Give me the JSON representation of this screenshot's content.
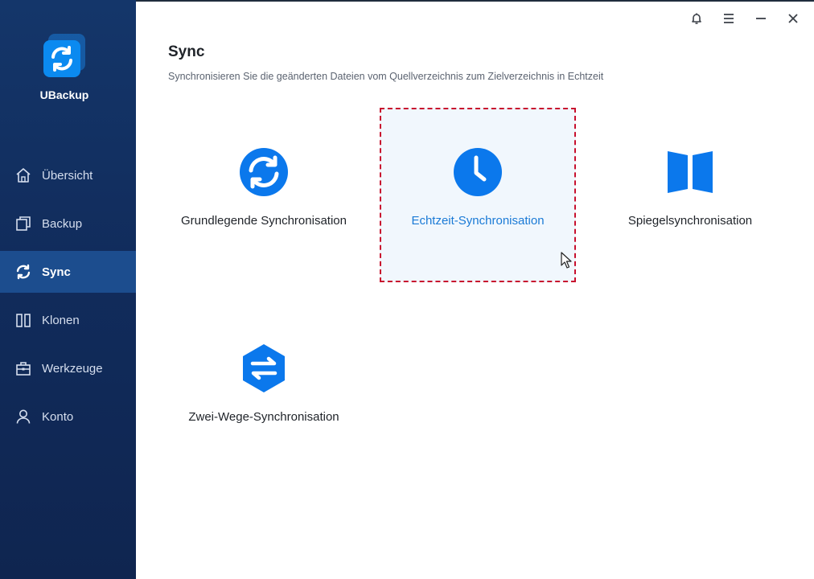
{
  "app": {
    "name": "UBackup"
  },
  "sidebar": {
    "items": [
      {
        "label": "Übersicht",
        "icon": "home-icon"
      },
      {
        "label": "Backup",
        "icon": "backup-icon"
      },
      {
        "label": "Sync",
        "icon": "sync-icon",
        "active": true
      },
      {
        "label": "Klonen",
        "icon": "clone-icon"
      },
      {
        "label": "Werkzeuge",
        "icon": "toolbox-icon"
      },
      {
        "label": "Konto",
        "icon": "user-icon"
      }
    ]
  },
  "window_controls": [
    "bell-icon",
    "menu-icon",
    "minimize-icon",
    "close-icon"
  ],
  "page": {
    "title": "Sync",
    "subtitle": "Synchronisieren Sie die geänderten Dateien vom Quellverzeichnis zum Zielverzeichnis in Echtzeit"
  },
  "options": [
    {
      "label": "Grundlegende Synchronisation",
      "icon": "basic-sync-icon"
    },
    {
      "label": "Echtzeit-Synchronisation",
      "icon": "realtime-clock-icon",
      "selected": true
    },
    {
      "label": "Spiegelsynchronisation",
      "icon": "mirror-icon"
    },
    {
      "label": "Zwei-Wege-Synchronisation",
      "icon": "two-way-arrows-icon"
    }
  ],
  "colors": {
    "sidebar_bg": "#112c5c",
    "sidebar_active": "#1c4d8e",
    "accent_blue": "#1a7ad6",
    "icon_blue": "#0b78ec",
    "selection_border": "#c8102e",
    "selection_bg": "#f1f7fd"
  }
}
